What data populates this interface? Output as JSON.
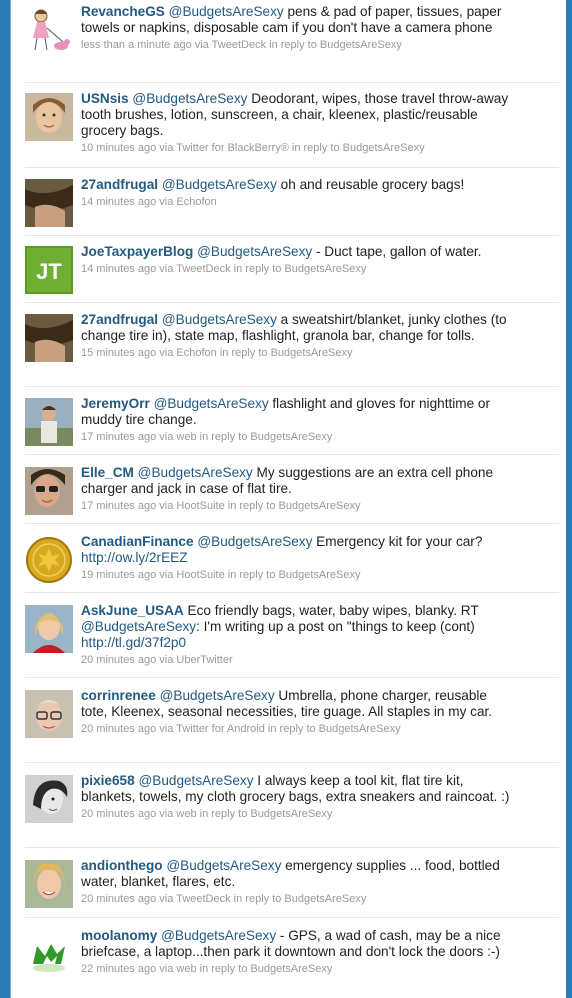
{
  "tweets": [
    {
      "user": "RevancheGS",
      "mention": "@BudgetsAreSexy",
      "text": " pens & pad of paper, tissues, paper towels or napkins, disposable cam if you don't have a camera phone",
      "link": "",
      "time": "less than a minute ago",
      "via": "via TweetDeck",
      "reply": "in reply to BudgetsAreSexy",
      "avatar": "cartoon-girl-dog-avatar"
    },
    {
      "user": "USNsis",
      "mention": "@BudgetsAreSexy",
      "text": " Deodorant, wipes, those travel throw-away tooth brushes, lotion, sunscreen, a chair, kleenex, plastic/reusable grocery bags.",
      "link": "",
      "time": "10 minutes ago",
      "via": "via Twitter for BlackBerry®",
      "reply": "in reply to BudgetsAreSexy",
      "avatar": "woman-portrait-avatar"
    },
    {
      "user": "27andfrugal",
      "mention": "@BudgetsAreSexy",
      "text": " oh and reusable grocery bags!",
      "link": "",
      "time": "14 minutes ago",
      "via": "via Echofon",
      "reply": "",
      "avatar": "hair-closeup-avatar"
    },
    {
      "user": "JoeTaxpayerBlog",
      "mention": "@BudgetsAreSexy",
      "text": " - Duct tape, gallon of water.",
      "link": "",
      "time": "14 minutes ago",
      "via": "via TweetDeck",
      "reply": "in reply to BudgetsAreSexy",
      "avatar": "jt-logo-avatar"
    },
    {
      "user": "27andfrugal",
      "mention": "@BudgetsAreSexy",
      "text": " a sweatshirt/blanket, junky clothes (to change tire in), state map, flashlight, granola bar, change for tolls.",
      "link": "",
      "time": "15 minutes ago",
      "via": "via Echofon",
      "reply": "in reply to BudgetsAreSexy",
      "avatar": "hair-closeup-avatar"
    },
    {
      "user": "JeremyOrr",
      "mention": "@BudgetsAreSexy",
      "text": " flashlight and gloves for nighttime or muddy tire change.",
      "link": "",
      "time": "17 minutes ago",
      "via": "via web",
      "reply": "in reply to BudgetsAreSexy",
      "avatar": "man-outdoor-avatar"
    },
    {
      "user": "Elle_CM",
      "mention": "@BudgetsAreSexy",
      "text": " My suggestions are an extra cell phone charger and jack in case of flat tire.",
      "link": "",
      "time": "17 minutes ago",
      "via": "via HootSuite",
      "reply": "in reply to BudgetsAreSexy",
      "avatar": "woman-sunglasses-avatar"
    },
    {
      "user": "CanadianFinance",
      "mention": "@BudgetsAreSexy",
      "text": " Emergency kit for your car?",
      "link": "http://ow.ly/2rEEZ",
      "time": "19 minutes ago",
      "via": "via HootSuite",
      "reply": "in reply to BudgetsAreSexy",
      "avatar": "gold-coin-avatar"
    },
    {
      "user": "AskJune_USAA",
      "mention": "@BudgetsAreSexy",
      "text": ": I'm writing up a post on \"things to keep (cont)",
      "prefix": " Eco friendly bags, water, baby wipes, blanky. RT ",
      "link": "http://tl.gd/37f2p0",
      "time": "20 minutes ago",
      "via": "via UberTwitter",
      "reply": "",
      "avatar": "blonde-woman-avatar"
    },
    {
      "user": "corrinrenee",
      "mention": "@BudgetsAreSexy",
      "text": " Umbrella, phone charger, reusable tote, Kleenex, seasonal necessities, tire guage. All staples in my car.",
      "link": "",
      "time": "20 minutes ago",
      "via": "via Twitter for Android",
      "reply": "in reply to BudgetsAreSexy",
      "avatar": "woman-glasses-avatar"
    },
    {
      "user": "pixie658",
      "mention": "@BudgetsAreSexy",
      "text": " I always keep a tool kit, flat tire kit, blankets, towels, my cloth grocery bags, extra sneakers and raincoat. :)",
      "link": "",
      "time": "20 minutes ago",
      "via": "via web",
      "reply": "in reply to BudgetsAreSexy",
      "avatar": "bw-woman-avatar"
    },
    {
      "user": "andionthego",
      "mention": "@BudgetsAreSexy",
      "text": " emergency supplies ... food, bottled water, blanket, flares, etc.",
      "link": "",
      "time": "20 minutes ago",
      "via": "via TweetDeck",
      "reply": "in reply to BudgetsAreSexy",
      "avatar": "smiling-woman-avatar"
    },
    {
      "user": "moolanomy",
      "mention": "@BudgetsAreSexy",
      "text": " - GPS, a wad of cash, may be a nice briefcase, a laptop...then park it downtown and don't lock the doors :-)",
      "link": "",
      "time": "22 minutes ago",
      "via": "via web",
      "reply": "in reply to BudgetsAreSexy",
      "avatar": "green-m-logo-avatar"
    }
  ]
}
